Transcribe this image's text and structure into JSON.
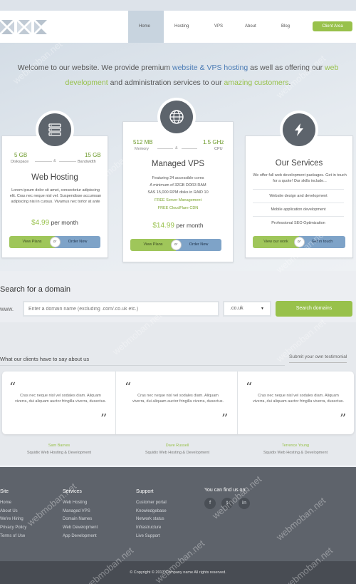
{
  "nav": {
    "items": [
      "Home",
      "Hosting",
      "VPS",
      "About",
      "Blog"
    ],
    "client_area": "Client Area"
  },
  "intro": {
    "p1": "Welcome to our website. We provide premium ",
    "link1": "website & VPS hosting",
    "p2": " as well as offering our ",
    "link2": "web development",
    "p3": " and administration services to our ",
    "link3": "amazing customers",
    "p4": "."
  },
  "web_hosting": {
    "stat1_value": "5 GB",
    "stat1_label": "Diskspace",
    "stat2_value": "15 GB",
    "stat2_label": "Bandwidth",
    "amp": "&",
    "title": "Web Hosting",
    "text": "Lorem ipsum dolor sit amet, consectetur adipiscing elit. Cras nec neque nisl vel. Suspendisse accumsan adipiscing nisi in cursus. Vivamus nec tortor at ante",
    "price": "$4.99",
    "per": "per month",
    "btn_left": "View Plans",
    "btn_or": "or",
    "btn_right": "Order Now"
  },
  "managed_vps": {
    "stat1_value": "512 MB",
    "stat1_label": "Memory",
    "stat2_value": "1.5 GHz",
    "stat2_label": "CPU",
    "amp": "&",
    "title": "Managed VPS",
    "features": [
      "Featuring 24 accessible cores",
      "A minimum of 32GB DDR3 RAM",
      "SAS 15,000 RPM disks in RAID 10"
    ],
    "free_features": [
      "FREE Server Management",
      "FREE CloudFlare CDN"
    ],
    "price": "$14.99",
    "per": "per month",
    "btn_left": "View Plans",
    "btn_or": "or",
    "btn_right": "Order Now"
  },
  "our_services": {
    "title": "Our Services",
    "text": "We offer full web development packages. Get in touch for a quote! Our skills include...",
    "items": [
      "Website design and development",
      "Mobile application development",
      "Professional SEO Optimization"
    ],
    "btn_left": "View our work",
    "btn_or": "or",
    "btn_right": "Get in touch"
  },
  "domain": {
    "title": "Search for a domain",
    "prefix": "www.",
    "placeholder": "Enter a domain name (excluding .com/.co.uk etc.)",
    "tld": ".co.uk",
    "search_btn": "Search domains"
  },
  "testimonials": {
    "title": "What our clients have to say about us",
    "submit_link": "Submit your own testimonial",
    "quotes": [
      "Cras nec neque nisl vel sodales diam. Aliquam viverra, dui aliquam auctor fringilla viverra, dusectus.",
      "Cras nec neque nisl vel sodales diam. Aliquam viverra, dui aliquam auctor fringilla viverra, dusectus.",
      "Cras nec neque nisl vel sodales diam. Aliquam viverra, dui aliquam auctor fringilla viverra, dusectus."
    ],
    "authors": [
      {
        "name": "Sam Barnes",
        "company": "Squidix Web Hosting & Development"
      },
      {
        "name": "Dave Russell",
        "company": "Squidix Web Hosting & Development"
      },
      {
        "name": "Terrence Young",
        "company": "Squidix Web Hosting & Development"
      }
    ]
  },
  "footer": {
    "site": {
      "heading": "Site",
      "items": [
        "Home",
        "About Us",
        "We're Hiring",
        "Privacy Policy",
        "Terms of Use"
      ]
    },
    "services": {
      "heading": "Services",
      "items": [
        "Web Hosting",
        "Managed VPS",
        "Domain Names",
        "Web Development",
        "App Development"
      ]
    },
    "support": {
      "heading": "Support",
      "items": [
        "Customer portal",
        "Knowledgebase",
        "Network status",
        "Infrastructure",
        "Live Support"
      ]
    },
    "social": {
      "heading": "You can find us on...",
      "icons": [
        "f",
        "t",
        "in"
      ]
    },
    "copyright": "© Copyright © 2013 Company name All rights reserved."
  },
  "watermark": "webmoban.net"
}
